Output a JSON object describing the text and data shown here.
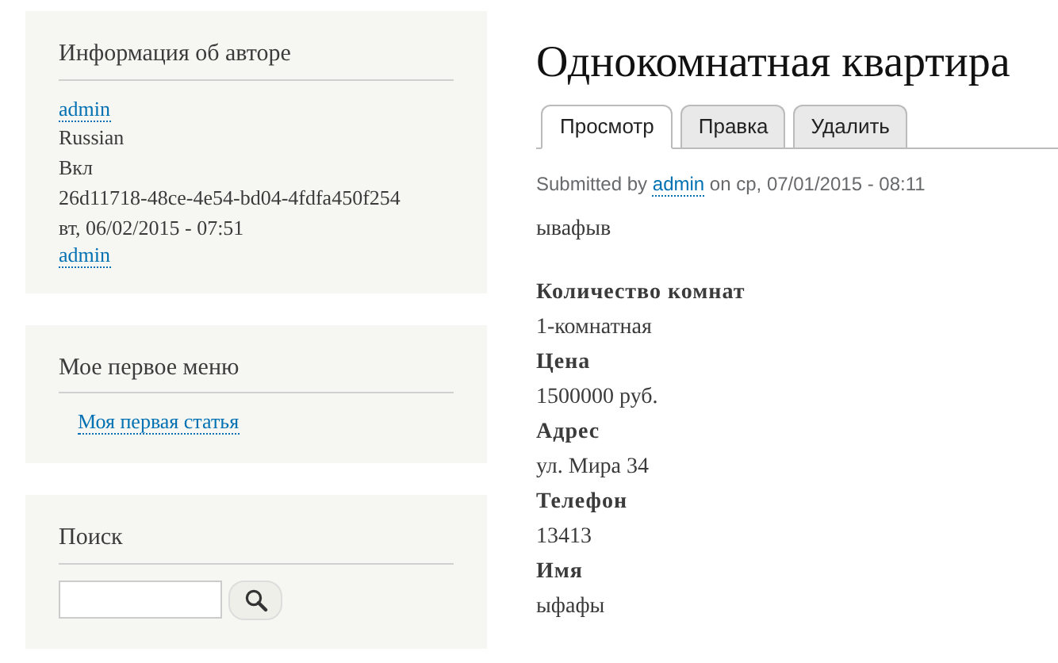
{
  "author_block": {
    "title": "Информация об авторе",
    "lines": [
      {
        "kind": "link",
        "text": "admin"
      },
      {
        "kind": "text",
        "text": "Russian"
      },
      {
        "kind": "text",
        "text": "Вкл"
      },
      {
        "kind": "text",
        "text": "26d11718-48ce-4e54-bd04-4fdfa450f254"
      },
      {
        "kind": "text",
        "text": "вт, 06/02/2015 - 07:51"
      },
      {
        "kind": "link",
        "text": "admin"
      }
    ]
  },
  "menu_block": {
    "title": "Мое первое меню",
    "items": [
      "Моя первая статья"
    ]
  },
  "search_block": {
    "title": "Поиск"
  },
  "page": {
    "title": "Однокомнатная квартира",
    "tabs": [
      {
        "label": "Просмотр",
        "selected": true
      },
      {
        "label": "Правка",
        "selected": false
      },
      {
        "label": "Удалить",
        "selected": false
      }
    ],
    "submitted": {
      "prefix": "Submitted by",
      "author": "admin",
      "suffix": "on ср, 07/01/2015 - 08:11"
    },
    "body": "ывафыв",
    "fields": [
      {
        "label": "Количество комнат",
        "value": "1-комнатная"
      },
      {
        "label": "Цена",
        "value": "1500000 руб."
      },
      {
        "label": "Адрес",
        "value": "ул. Мира 34"
      },
      {
        "label": "Телефон",
        "value": "13413"
      },
      {
        "label": "Имя",
        "value": "ыфафы"
      }
    ]
  }
}
